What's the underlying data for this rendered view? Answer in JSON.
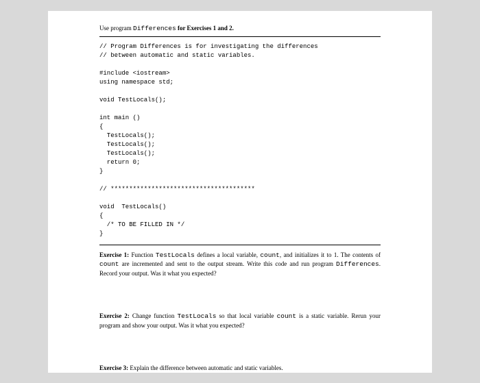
{
  "heading": {
    "prefix": "Use program ",
    "program": "Differences",
    "suffix": "  for Exercises 1 and 2."
  },
  "code": "// Program Differences is for investigating the differences\n// between automatic and static variables.\n\n#include <iostream>\nusing namespace std;\n\nvoid TestLocals();\n\nint main ()\n{\n  TestLocals();\n  TestLocals();\n  TestLocals();\n  return 0;\n}\n\n// ***************************************\n\nvoid  TestLocals()\n{\n  /* TO BE FILLED IN */\n}",
  "ex1": {
    "label": "Exercise 1:",
    "t1": "  Function ",
    "c1": "TestLocals",
    "t2": " defines a local variable, ",
    "c2": "count",
    "t3": ", and initializes it to 1. The contents of ",
    "c3": "count",
    "t4": " are incremented and sent to the output stream. Write this code and run program ",
    "c4": "Differences",
    "t5": ". Record your output. Was it what you expected?"
  },
  "ex2": {
    "label": "Exercise 2:",
    "t1": "  Change function ",
    "c1": "TestLocals",
    "t2": " so that local variable ",
    "c2": "count",
    "t3": " is a static variable. Rerun your program and show your output. Was it what you expected?"
  },
  "ex3": {
    "label": "Exercise 3:",
    "t1": "  Explain the difference between automatic and static variables."
  }
}
